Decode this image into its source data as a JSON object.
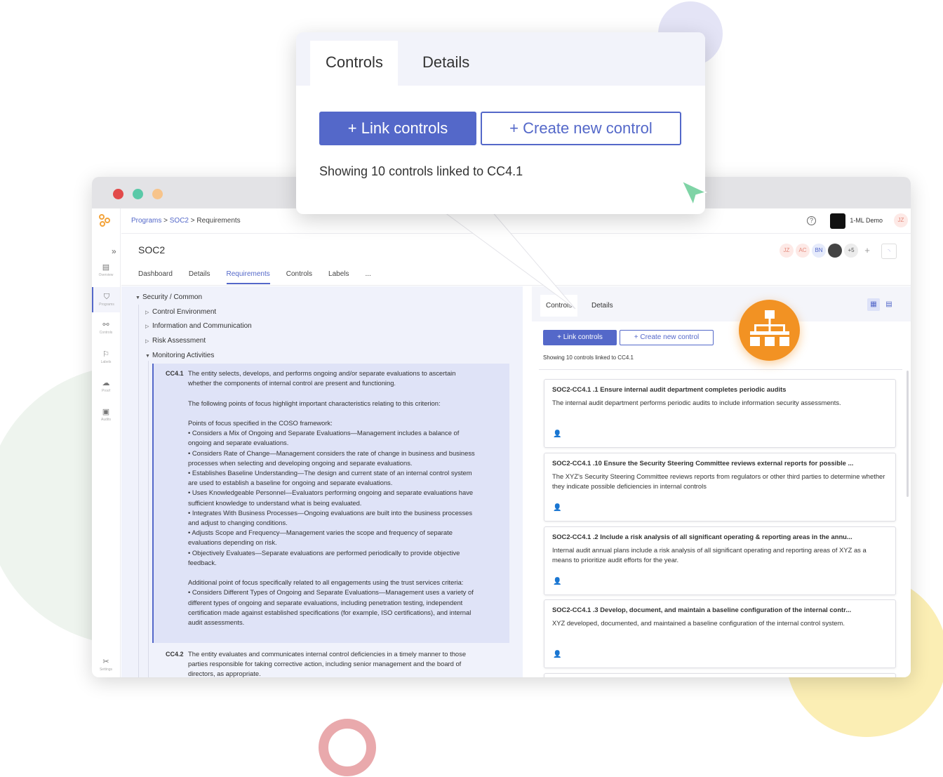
{
  "window": {
    "breadcrumb": {
      "programs": "Programs",
      "sep1": " > ",
      "soc2": "SOC2",
      "sep2": " > ",
      "current": "Requirements"
    },
    "org_name": "1-ML Demo",
    "user_initials": "JZ",
    "help_label": "?"
  },
  "sidenav": {
    "expand_label": "»",
    "items": [
      {
        "label": "Overview",
        "icon": "overview-icon"
      },
      {
        "label": "Programs",
        "icon": "shield-icon"
      },
      {
        "label": "Controls",
        "icon": "controls-icon"
      },
      {
        "label": "Labels",
        "icon": "label-icon"
      },
      {
        "label": "Proof",
        "icon": "cloud-upload-icon"
      },
      {
        "label": "Audits",
        "icon": "audit-icon"
      },
      {
        "label": "Settings",
        "icon": "tools-icon"
      }
    ]
  },
  "page": {
    "title": "SOC2",
    "tabs": [
      "Dashboard",
      "Details",
      "Requirements",
      "Controls",
      "Labels",
      "..."
    ],
    "active_tab": "Requirements",
    "avatars": [
      "JZ",
      "AC",
      "BN"
    ],
    "more_count": "+5",
    "add_label": "+"
  },
  "tree": {
    "root": "Security / Common",
    "children": [
      "Control Environment",
      "Information and Communication",
      "Risk Assessment",
      "Monitoring Activities"
    ],
    "cc41": {
      "id": "CC4.1",
      "text": "The entity selects, develops, and performs ongoing and/or separate evaluations to ascertain\nwhether the components of internal control are present and functioning.\n\nThe following points of focus highlight important characteristics relating to this criterion:\n\nPoints of focus specified in the COSO framework:\n• Considers a Mix of Ongoing and Separate Evaluations—Management includes a balance of\nongoing and separate evaluations.\n• Considers Rate of Change—Management considers the rate of change in business and business\nprocesses when selecting and developing ongoing and separate evaluations.\n• Establishes Baseline Understanding—The design and current state of an internal control system\nare used to establish a baseline for ongoing and separate evaluations.\n• Uses Knowledgeable Personnel—Evaluators performing ongoing and separate evaluations have\nsufficient knowledge to understand what is being evaluated.\n• Integrates With Business Processes—Ongoing evaluations are built into the business processes\nand adjust to changing conditions.\n• Adjusts Scope and Frequency—Management varies the scope and frequency of separate\nevaluations depending on risk.\n• Objectively Evaluates—Separate evaluations are performed periodically to provide objective\nfeedback.\n\nAdditional point of focus specifically related to all engagements using the trust services criteria:\n• Considers Different Types of Ongoing and Separate Evaluations—Management uses a variety of\ndifferent types of ongoing and separate evaluations, including penetration testing, independent\ncertification made against established specifications (for example, ISO certifications), and internal\naudit assessments."
    },
    "cc42": {
      "id": "CC4.2",
      "text": "The entity evaluates and communicates internal control deficiencies in a timely manner to those\nparties responsible for taking corrective action, including senior management and the board of\ndirectors, as appropriate."
    }
  },
  "controls_panel": {
    "tabs": [
      "Controls",
      "Details"
    ],
    "link_label": "Link controls",
    "create_label": "Create new control",
    "plus": "+",
    "showing": "Showing 10 controls linked to CC4.1",
    "cards": [
      {
        "title": "SOC2-CC4.1 .1 Ensure internal audit department completes periodic audits",
        "desc": "The internal audit department performs periodic audits to include information security assessments."
      },
      {
        "title": "SOC2-CC4.1 .10 Ensure the Security Steering Committee reviews external reports for possible ...",
        "desc": "The XYZ's Security Steering Committee reviews reports from regulators or other third parties to determine whether they indicate possible deficiencies in internal controls"
      },
      {
        "title": "SOC2-CC4.1 .2 Include a risk analysis of all significant operating & reporting areas in the annu...",
        "desc": "Internal audit annual plans include a risk analysis of all significant operating and reporting areas of XYZ as a means to prioritize audit efforts for the year."
      },
      {
        "title": "SOC2-CC4.1 .3 Develop, document, and maintain a baseline configuration of the internal contr...",
        "desc": "XYZ developed, documented, and maintained a baseline configuration of the internal control system."
      }
    ]
  },
  "zoom": {
    "tabs": [
      "Controls",
      "Details"
    ],
    "link_label": "Link controls",
    "create_label": "Create new control",
    "plus": "+",
    "showing": "Showing 10 controls linked to CC4.1"
  },
  "colors": {
    "accent": "#5468c9",
    "orange": "#f29223",
    "close_dot": "#e24a4a",
    "max_dot": "#5ac9a8",
    "min_dot": "#f7c48b"
  }
}
